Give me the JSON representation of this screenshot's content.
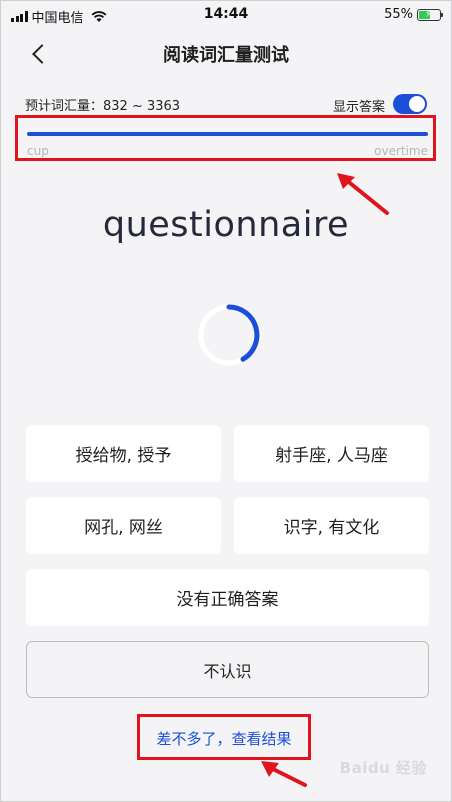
{
  "status_bar": {
    "carrier": "中国电信",
    "time": "14:44",
    "battery": "55%",
    "battery_level": 0.55
  },
  "nav": {
    "title": "阅读词汇量测试"
  },
  "vocab": {
    "label": "预计词汇量：832 ~ 3363",
    "toggle_label": "显示答案",
    "toggle_on": true
  },
  "progress": {
    "start_label": "cup",
    "end_label": "overtime",
    "fraction": 1.0
  },
  "word": "questionnaire",
  "options": [
    "授给物, 授予",
    "射手座, 人马座",
    "网孔, 网丝",
    "识字, 有文化"
  ],
  "no_answer": "没有正确答案",
  "dont_know": "不认识",
  "result_link": "差不多了，查看结果",
  "watermark": "Baidu 经验",
  "colors": {
    "accent": "#1b4fd8",
    "highlight": "#e0141d",
    "background": "#f4f4f6"
  }
}
